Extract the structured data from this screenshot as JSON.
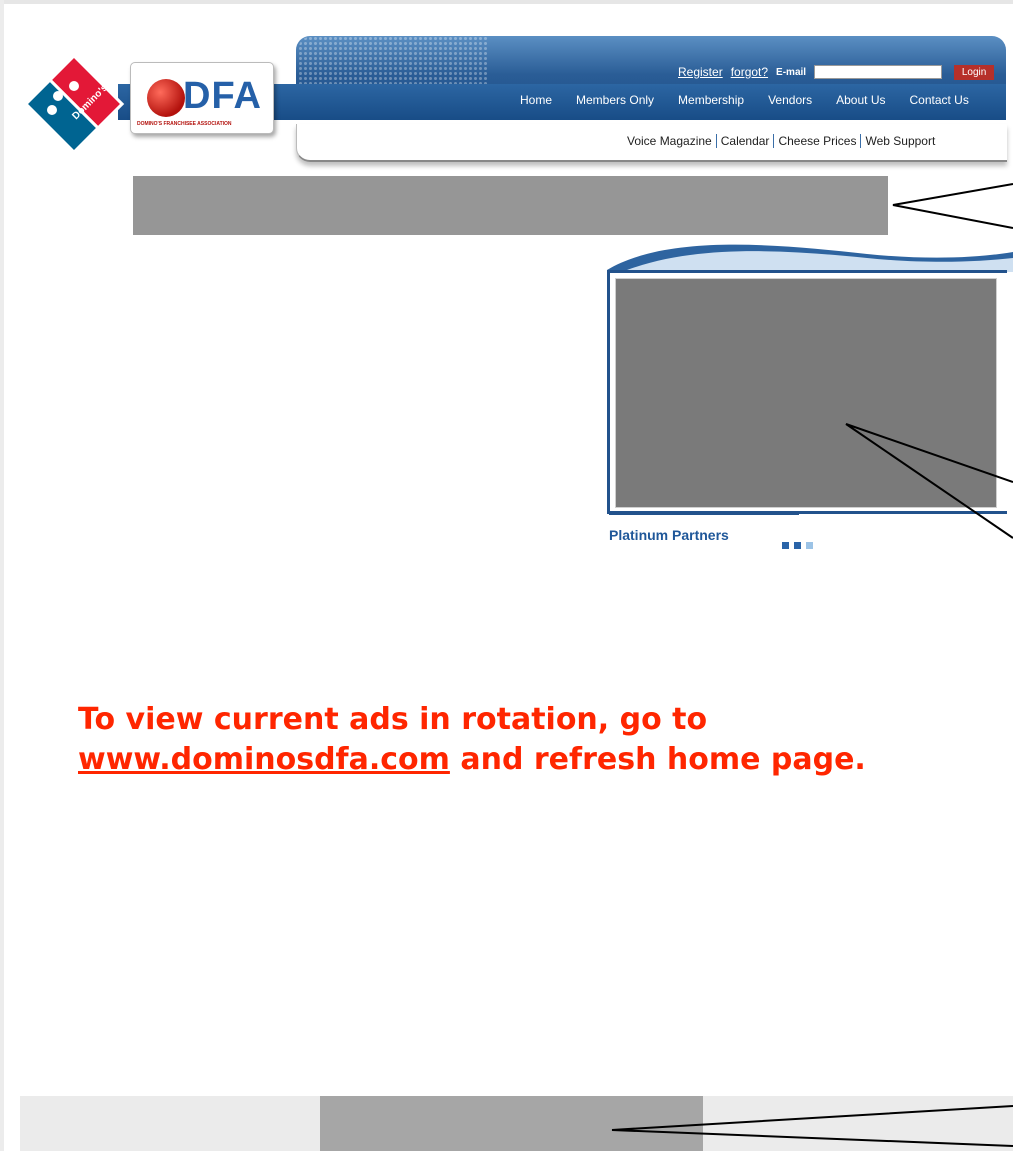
{
  "header": {
    "register_label": "Register",
    "forgot_label": "forgot?",
    "email_label": "E-mail",
    "email_value": "",
    "login_label": "Login",
    "nav": [
      "Home",
      "Members Only",
      "Membership",
      "Vendors",
      "About Us",
      "Contact Us"
    ],
    "subnav": [
      "Voice Magazine",
      "Calendar",
      "Cheese Prices",
      "Web Support"
    ],
    "dfa_logo_text": "DFA",
    "dfa_logo_subtitle": "DOMINO'S FRANCHISEE ASSOCIATION",
    "dominos_logo_text": "Domino's Pizza"
  },
  "partners": {
    "label": "Platinum Partners"
  },
  "message": {
    "line1": "To view current ads in rotation, go to",
    "link": "www.dominosdfa.com",
    "line2_rest": " and refresh home page."
  },
  "colors": {
    "header_blue": "#1b4b86",
    "message_red": "#ff2600",
    "login_red": "#b6302a",
    "banner_placeholder": "#969696",
    "partners_placeholder": "#7a7a7a",
    "bottom_placeholder": "#a6a6a6"
  }
}
